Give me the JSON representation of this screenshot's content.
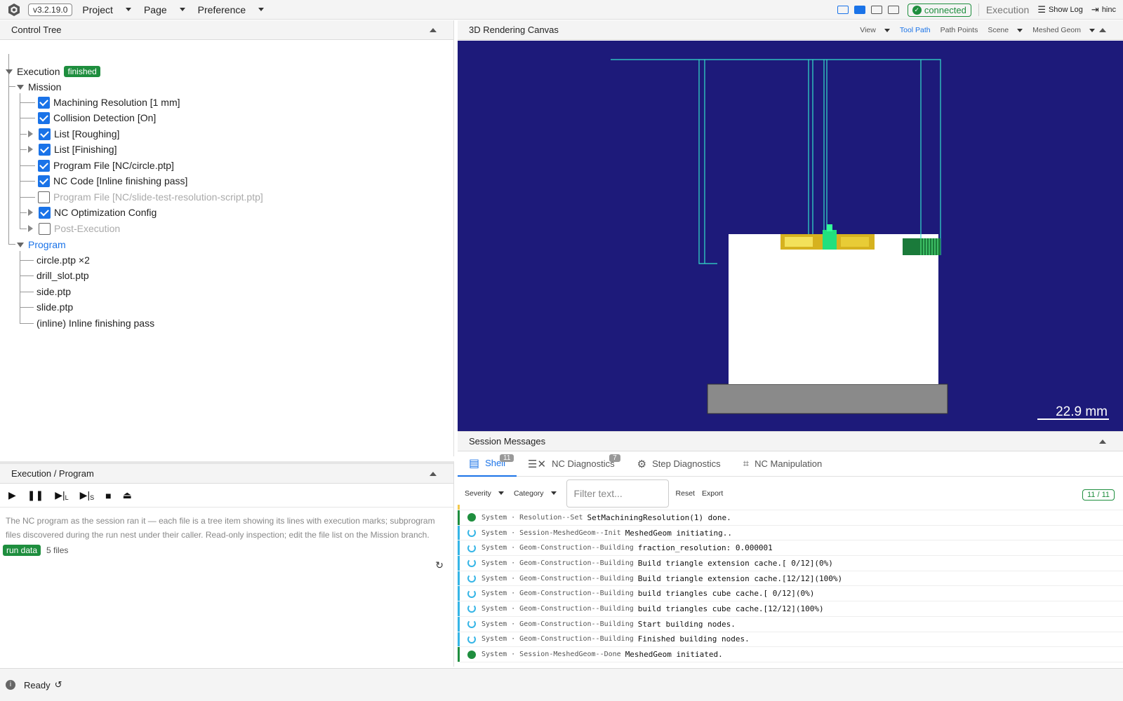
{
  "topbar": {
    "version": "v3.2.19.0",
    "menus": [
      "Project",
      "Page",
      "Preference"
    ],
    "connection": "connected",
    "mode": "Execution",
    "show_log": "Show Log",
    "user": "hinc"
  },
  "control_tree": {
    "title": "Control Tree",
    "root_label": "Execution",
    "root_status": "finished",
    "mission_label": "Mission",
    "mission_items": [
      {
        "label": "Machining Resolution [1 mm]",
        "checked": true
      },
      {
        "label": "Collision Detection [On]",
        "checked": true
      },
      {
        "label": "List [Roughing]",
        "checked": true
      },
      {
        "label": "List [Finishing]",
        "checked": true
      },
      {
        "label": "Program File [NC/circle.ptp]",
        "checked": true
      },
      {
        "label": "NC Code [Inline finishing pass]",
        "checked": true
      },
      {
        "label": "Program File [NC/slide-test-resolution-script.ptp]",
        "checked": false
      },
      {
        "label": "NC Optimization Config",
        "checked": true
      },
      {
        "label": "Post-Execution",
        "checked": false
      }
    ],
    "program_label": "Program",
    "program_items": [
      "circle.ptp ×2",
      "drill_slot.ptp",
      "side.ptp",
      "slide.ptp",
      "(inline) Inline finishing pass"
    ]
  },
  "exec_program": {
    "title": "Execution / Program",
    "description": "The NC program as the session ran it — each file is a tree item showing its lines with execution marks; subprogram files discovered during the run nest under their caller. Read-only inspection; edit the file list on the Mission branch.",
    "badge": "run data",
    "files": "5 files",
    "controls": {
      "step_line_sub": "L",
      "step_sub_sub": "S"
    }
  },
  "canvas": {
    "title": "3D Rendering Canvas",
    "tools": [
      "View",
      "Tool Path",
      "Path Points",
      "Scene",
      "Meshed Geom"
    ],
    "active_tool": "Tool Path",
    "scale_label": "22.9 mm",
    "background": "#1d1a7a"
  },
  "session": {
    "title": "Session Messages",
    "tabs": [
      {
        "label": "Shell",
        "badge": "11"
      },
      {
        "label": "NC Diagnostics",
        "badge": "7"
      },
      {
        "label": "Step Diagnostics",
        "badge": ""
      },
      {
        "label": "NC Manipulation",
        "badge": ""
      }
    ],
    "filter_severity": "Severity",
    "filter_category": "Category",
    "filter_placeholder": "Filter text...",
    "reset": "Reset",
    "export": "Export",
    "count": "11 / 11",
    "messages": [
      {
        "type": "ok",
        "source": "System · Resolution--Set",
        "text": "SetMachiningResolution(1) done."
      },
      {
        "type": "spin",
        "source": "System · Session-MeshedGeom--Init",
        "text": "MeshedGeom initiating.."
      },
      {
        "type": "spin",
        "source": "System · Geom-Construction--Building",
        "text": "fraction_resolution: 0.000001"
      },
      {
        "type": "spin",
        "source": "System · Geom-Construction--Building",
        "text": "Build triangle extension cache.[ 0/12](0%)"
      },
      {
        "type": "spin",
        "source": "System · Geom-Construction--Building",
        "text": "Build triangle extension cache.[12/12](100%)"
      },
      {
        "type": "spin",
        "source": "System · Geom-Construction--Building",
        "text": "build triangles cube cache.[ 0/12](0%)"
      },
      {
        "type": "spin",
        "source": "System · Geom-Construction--Building",
        "text": "build triangles cube cache.[12/12](100%)"
      },
      {
        "type": "spin",
        "source": "System · Geom-Construction--Building",
        "text": "Start building nodes."
      },
      {
        "type": "spin",
        "source": "System · Geom-Construction--Building",
        "text": "Finished building nodes."
      },
      {
        "type": "ok",
        "source": "System · Session-MeshedGeom--Done",
        "text": "MeshedGeom initiated."
      }
    ]
  },
  "status": {
    "text": "Ready"
  }
}
